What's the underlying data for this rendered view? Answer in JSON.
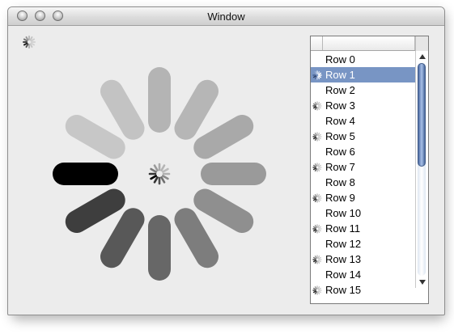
{
  "window": {
    "title": "Window"
  },
  "progress_indicators": {
    "small_spinner": {
      "state": "spinning"
    },
    "large_spinner": {
      "state": "spinning",
      "bars": 12,
      "highlighted_bar": "left-bottom"
    },
    "center_spinner": {
      "state": "spinning"
    }
  },
  "table": {
    "columns": [
      "",
      ""
    ],
    "selected_row": 1,
    "rows": [
      {
        "label": "Row 0",
        "spinner": false
      },
      {
        "label": "Row 1",
        "spinner": true
      },
      {
        "label": "Row 2",
        "spinner": false
      },
      {
        "label": "Row 3",
        "spinner": true
      },
      {
        "label": "Row 4",
        "spinner": false
      },
      {
        "label": "Row 5",
        "spinner": true
      },
      {
        "label": "Row 6",
        "spinner": false
      },
      {
        "label": "Row 7",
        "spinner": true
      },
      {
        "label": "Row 8",
        "spinner": false
      },
      {
        "label": "Row 9",
        "spinner": true
      },
      {
        "label": "Row 10",
        "spinner": false
      },
      {
        "label": "Row 11",
        "spinner": true
      },
      {
        "label": "Row 12",
        "spinner": false
      },
      {
        "label": "Row 13",
        "spinner": true
      },
      {
        "label": "Row 14",
        "spinner": false
      },
      {
        "label": "Row 15",
        "spinner": true
      }
    ]
  },
  "colors": {
    "selection": "#7895c4",
    "spinner_dark": "#000000",
    "spinner_light": "#c8c8c8"
  }
}
